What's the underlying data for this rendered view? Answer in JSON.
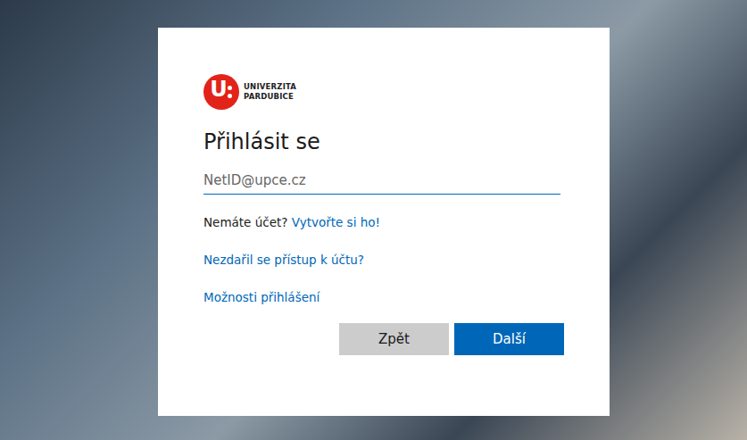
{
  "logo": {
    "mark": "U",
    "line1": "UNIVERZITA",
    "line2": "PARDUBICE"
  },
  "title": "Přihlásit se",
  "input": {
    "placeholder": "NetID@upce.cz"
  },
  "account": {
    "text": "Nemáte účet? ",
    "link": "Vytvořte si ho!"
  },
  "links": [
    "Nezdařil se přístup k účtu?",
    "Možnosti přihlášení"
  ],
  "buttons": [
    {
      "label": "Zpět",
      "kind": "secondary"
    },
    {
      "label": "Další",
      "kind": "primary"
    }
  ]
}
